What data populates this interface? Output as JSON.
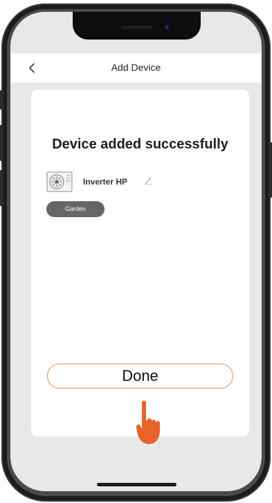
{
  "header": {
    "title": "Add Device",
    "back_icon": "chevron-left-icon"
  },
  "card": {
    "success_message": "Device added successfully",
    "device": {
      "icon": "heat-pump-icon",
      "name": "Inverter HP",
      "edit_icon": "pencil-icon"
    },
    "room_badge": "Garden",
    "done_label": "Done"
  },
  "colors": {
    "accent": "#f28a54",
    "badge_bg": "#666666",
    "screen_bg": "#e8e8e8",
    "hand": "#e8622a"
  },
  "decorations": {
    "hand_icon": "pointing-hand-icon"
  }
}
